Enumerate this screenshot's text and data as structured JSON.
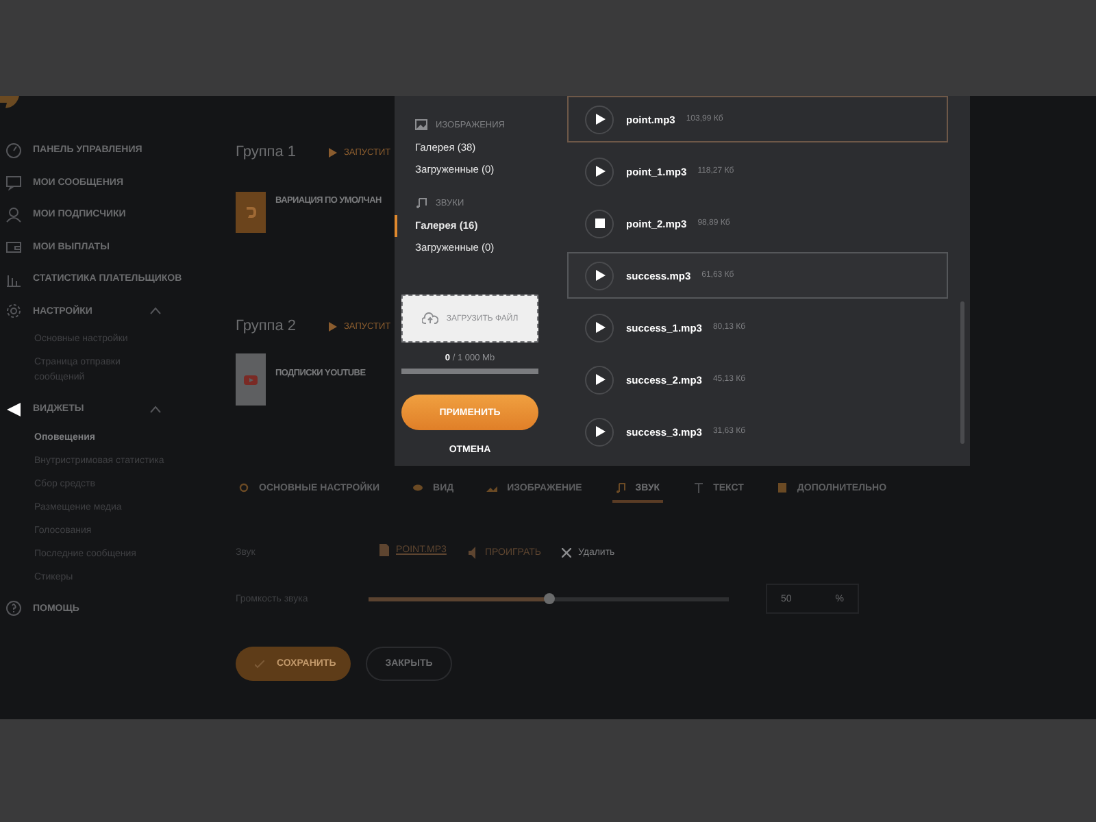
{
  "sidebar": {
    "items": [
      {
        "label": "ПАНЕЛЬ УПРАВЛЕНИЯ"
      },
      {
        "label": "МОИ СООБЩЕНИЯ"
      },
      {
        "label": "МОИ ПОДПИСЧИКИ"
      },
      {
        "label": "МОИ ВЫПЛАТЫ"
      },
      {
        "label": "СТАТИСТИКА ПЛАТЕЛЬЩИКОВ"
      },
      {
        "label": "НАСТРОЙКИ",
        "expanded": true,
        "children": [
          {
            "label": "Основные настройки",
            "selected": false
          },
          {
            "label": "Страница отправки сообщений",
            "selected": false
          }
        ]
      },
      {
        "label": "ВИДЖЕТЫ",
        "expanded": true,
        "children": [
          {
            "label": "Оповещения",
            "selected": true
          },
          {
            "label": "Внутристримовая статистика",
            "selected": false
          },
          {
            "label": "Сбор средств",
            "selected": false
          },
          {
            "label": "Размещение медиа",
            "selected": false
          },
          {
            "label": "Голосования",
            "selected": false
          },
          {
            "label": "Последние сообщения",
            "selected": false
          },
          {
            "label": "Стикеры",
            "selected": false
          }
        ]
      },
      {
        "label": "ПОМОЩЬ"
      }
    ]
  },
  "groups": [
    {
      "title": "Группа 1",
      "action": "ЗАПУСТИТ",
      "widgets": [
        {
          "label": "ВАРИАЦИЯ ПО УМОЛЧАН",
          "kind": "default"
        }
      ]
    },
    {
      "title": "Группа 2",
      "action": "ЗАПУСТИТ",
      "widgets": [
        {
          "label": "ПОДПИСКИ YOUTUBE",
          "kind": "youtube"
        }
      ]
    }
  ],
  "tabs": [
    {
      "label": "ОСНОВНЫЕ НАСТРОЙКИ",
      "selected": false
    },
    {
      "label": "ВИД",
      "selected": false
    },
    {
      "label": "ИЗОБРАЖЕНИЕ",
      "selected": false
    },
    {
      "label": "ЗВУК",
      "selected": true
    },
    {
      "label": "ТЕКСТ",
      "selected": false
    },
    {
      "label": "ДОПОЛНИТЕЛЬНО",
      "selected": false
    }
  ],
  "sound_form": {
    "sound_label": "Звук",
    "file": "POINT.MP3",
    "play": "ПРОИГРАТЬ",
    "delete": "Удалить",
    "volume_label": "Громкость звука",
    "volume": {
      "level": 0.5
    },
    "volume_value": "50",
    "unit": "%"
  },
  "buttons": {
    "save": "СОХРАНИТЬ",
    "close": "ЗАКРЫТЬ"
  },
  "modal": {
    "categories": [
      {
        "title": "ИЗОБРАЖЕНИЯ",
        "items": [
          {
            "label": "Галерея (38)",
            "selected": false
          },
          {
            "label": "Загруженные (0)",
            "selected": false
          }
        ]
      },
      {
        "title": "ЗВУКИ",
        "items": [
          {
            "label": "Галерея (16)",
            "selected": true
          },
          {
            "label": "Загруженные (0)",
            "selected": false
          }
        ]
      }
    ],
    "upload": "ЗАГРУЗИТЬ ФАЙЛ",
    "storage_text": "**0** / 1 000 Mb",
    "storage": {
      "level": 0
    },
    "apply": "ПРИМЕНИТЬ",
    "cancel": "ОТМЕНА",
    "files": [
      {
        "name": "point.mp3",
        "size": "103,99 Кб",
        "selected": true,
        "hovered": false,
        "playing": false
      },
      {
        "name": "point_1.mp3",
        "size": "118,27 Кб",
        "selected": false,
        "hovered": false,
        "playing": false
      },
      {
        "name": "point_2.mp3",
        "size": "98,89 Кб",
        "selected": false,
        "hovered": false,
        "playing": true
      },
      {
        "name": "success.mp3",
        "size": "61,63 Кб",
        "selected": false,
        "hovered": true,
        "playing": false
      },
      {
        "name": "success_1.mp3",
        "size": "80,13 Кб",
        "selected": false,
        "hovered": false,
        "playing": false
      },
      {
        "name": "success_2.mp3",
        "size": "45,13 Кб",
        "selected": false,
        "hovered": false,
        "playing": false
      },
      {
        "name": "success_3.mp3",
        "size": "31,63 Кб",
        "selected": false,
        "hovered": false,
        "playing": false
      }
    ]
  }
}
